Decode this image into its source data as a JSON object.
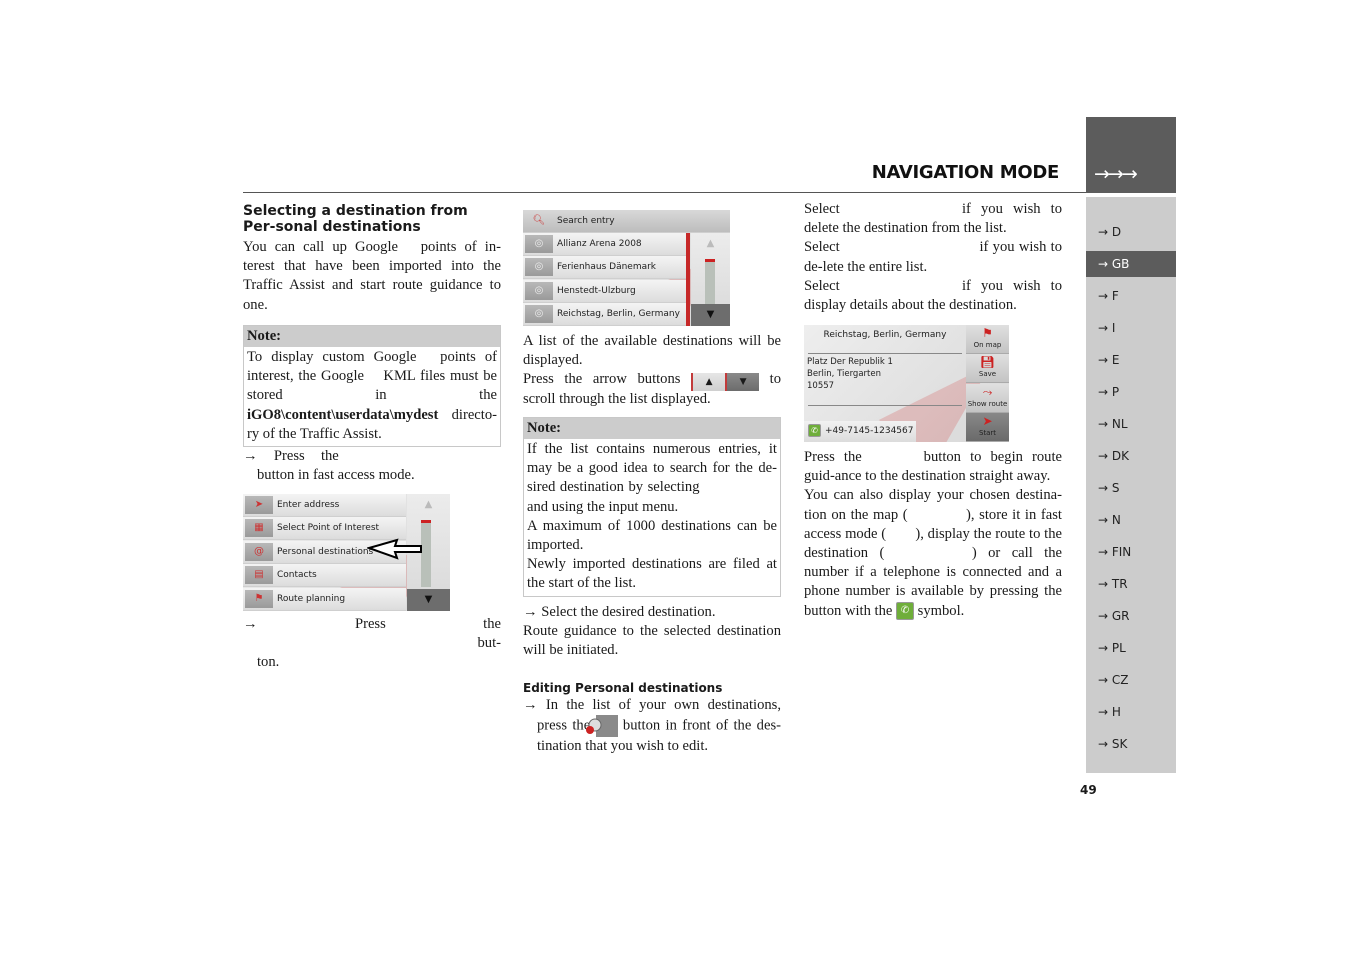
{
  "header": {
    "title": "NAVIGATION MODE",
    "tab_arrows": "→→→"
  },
  "language_nav": [
    {
      "label": "→ D",
      "active": false
    },
    {
      "label": "→ GB",
      "active": true
    },
    {
      "label": "→ F",
      "active": false
    },
    {
      "label": "→ I",
      "active": false
    },
    {
      "label": "→ E",
      "active": false
    },
    {
      "label": "→ P",
      "active": false
    },
    {
      "label": "→ NL",
      "active": false
    },
    {
      "label": "→ DK",
      "active": false
    },
    {
      "label": "→ S",
      "active": false
    },
    {
      "label": "→ N",
      "active": false
    },
    {
      "label": "→ FIN",
      "active": false
    },
    {
      "label": "→ TR",
      "active": false
    },
    {
      "label": "→ GR",
      "active": false
    },
    {
      "label": "→ PL",
      "active": false
    },
    {
      "label": "→ CZ",
      "active": false
    },
    {
      "label": "→ H",
      "active": false
    },
    {
      "label": "→ SK",
      "active": false
    }
  ],
  "page_number": "49",
  "col1": {
    "heading": "Selecting a destination from Per-sonal destinations",
    "intro": "You can call up Google  points of in-terest that have been imported into the Traffic Assist and start route guidance to one.",
    "note": {
      "title": "Note:",
      "text_before": "To display custom Google  points of interest, the Google  KML files must be stored in the ",
      "path": "iGO8\\content\\userdata\\mydest",
      "text_after": " directo-ry of the Traffic Assist."
    },
    "step1": "→ Press the            button in fast access mode.",
    "menu_screenshot": {
      "items": [
        {
          "icon": "enter-address-icon",
          "glyph": "➤",
          "label": "Enter address"
        },
        {
          "icon": "poi-icon",
          "glyph": "▦",
          "label": "Select Point of Interest"
        },
        {
          "icon": "personal-destinations-icon",
          "glyph": "@",
          "label": "Personal destinations"
        },
        {
          "icon": "contacts-icon",
          "glyph": "▤",
          "label": "Contacts"
        },
        {
          "icon": "route-planning-icon",
          "glyph": "⚑",
          "label": "Route planning"
        }
      ],
      "scroll_up": "▲",
      "scroll_down": "▼"
    },
    "step2": "→ Press the                but-ton."
  },
  "col2": {
    "list_screenshot": {
      "search_label": "Search entry",
      "items": [
        "Allianz Arena 2008",
        "Ferienhaus Dänemark",
        "Henstedt-Ulzburg",
        "Reichstag, Berlin, Germany"
      ],
      "scroll_up": "▲",
      "scroll_down": "▼"
    },
    "para1": "A list of the available destinations will be displayed.",
    "para2_before": "Press the arrow buttons ",
    "para2_after": " to scroll through the list displayed.",
    "arrow_up": "▲",
    "arrow_down": "▼",
    "note": {
      "title": "Note:",
      "text1": "If the list contains numerous entries, it may be a good idea to search for the de-sired destination by selecting       and using the input menu.",
      "text2": "A maximum of 1000 destinations can be imported.",
      "text3": "Newly imported destinations are filed at the start of the list."
    },
    "step1": "→ Select the desired destination.",
    "para3": "Route guidance to the selected destination will be initiated.",
    "subheading": "Editing Personal destinations",
    "step2_before": "→ In the list of your own destinations, press the ",
    "step2_after": " button in front of the des-tination that you wish to edit."
  },
  "col3": {
    "line1": "Select         if you wish to delete the destination from the list.",
    "line2": "Select           if you wish to de-lete the entire list.",
    "line3": "Select         if you wish to display details about the destination.",
    "detail_screenshot": {
      "title": "Reichstag, Berlin, Germany",
      "address_line1": "Platz Der Republik 1",
      "address_line2": "Berlin, Tiergarten",
      "address_line3": "10557",
      "phone": "+49-7145-1234567",
      "buttons": [
        "On map",
        "Save",
        "Show route",
        "Start"
      ]
    },
    "para1": "Press the     button to begin route guid-ance to the destination straight away.",
    "para2": "You can also display your chosen destina-tion on the map (    ), store it in fast access mode (  ), display the route to the destination (      ) or call the number if a telephone is connected and a phone number is available by pressing the button with the ",
    "para2_end": " symbol."
  }
}
